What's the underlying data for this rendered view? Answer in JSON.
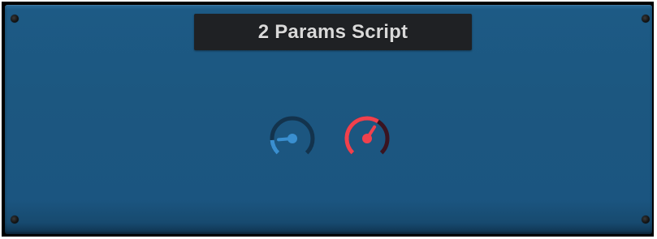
{
  "plugin": {
    "title": "2 Params Script",
    "colors": {
      "panel": "#1c5780",
      "title_bg": "#1f2124",
      "title_text": "#d9d9d9"
    }
  },
  "knobs": [
    {
      "name": "param-1",
      "value": 0.15,
      "color": "#3a8fd0",
      "track_color": "#13334d"
    },
    {
      "name": "param-2",
      "value": 0.62,
      "color": "#f0414d",
      "track_color": "#3a1420"
    }
  ]
}
